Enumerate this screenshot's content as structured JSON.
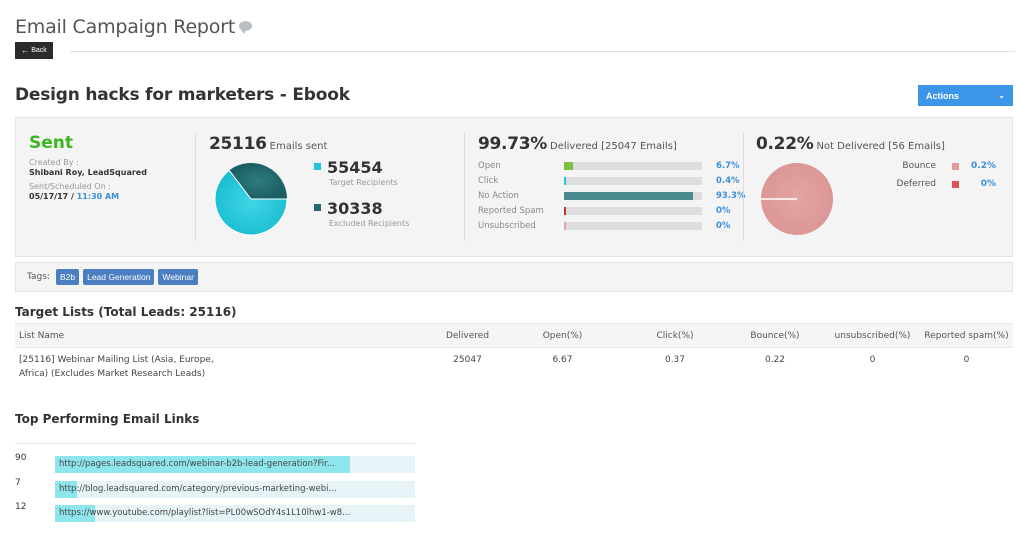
{
  "header": {
    "page_title": "Email Campaign Report",
    "back_label": "Back",
    "campaign_title": "Design hacks for marketers - Ebook",
    "actions_label": "Actions"
  },
  "status": {
    "label": "Sent",
    "created_by_label": "Created By :",
    "created_by": "Shibani Roy, LeadSquared",
    "scheduled_label": "Sent/Scheduled On :",
    "scheduled_date": "05/17/17 / ",
    "scheduled_time": "11:30 AM"
  },
  "sent": {
    "count": "25116",
    "suffix": "Emails sent",
    "target_count": "55454",
    "target_label": "Target Recipients",
    "excluded_count": "30338",
    "excluded_label": "Excluded Recipients",
    "colors": {
      "target": "#26c6da",
      "excluded": "#1f6b70"
    },
    "pie": {
      "target": 55454,
      "excluded": 30338
    }
  },
  "delivered": {
    "percent": "99.73%",
    "suffix": "Delivered [25047 Emails]",
    "metrics": [
      {
        "label": "Open",
        "value": "6.7%",
        "fraction": 0.067,
        "color": "#7ac143"
      },
      {
        "label": "Click",
        "value": "0.4%",
        "fraction": 0.004,
        "color": "#26c6da"
      },
      {
        "label": "No Action",
        "value": "93.3%",
        "fraction": 0.933,
        "color": "#4a8a8c"
      },
      {
        "label": "Reported Spam",
        "value": "0%",
        "fraction": 0.0,
        "color": "#c0392b"
      },
      {
        "label": "Unsubscribed",
        "value": "0%",
        "fraction": 0.0,
        "color": "#e8a0a0"
      }
    ]
  },
  "not_delivered": {
    "percent": "0.22%",
    "suffix": "Not Delivered [56 Emails]",
    "items": [
      {
        "label": "Bounce",
        "value": "0.2%",
        "color": "#e39a9a"
      },
      {
        "label": "Deferred",
        "value": "0%",
        "color": "#d9534f"
      }
    ]
  },
  "tags": {
    "label": "Tags:",
    "items": [
      "B2b",
      "Lead Generation",
      "Webinar"
    ]
  },
  "target_lists": {
    "title": "Target Lists (Total Leads: 25116)",
    "columns": [
      "List Name",
      "Delivered",
      "Open(%)",
      "Click(%)",
      "Bounce(%)",
      "unsubscribed(%)",
      "Reported spam(%)"
    ],
    "rows": [
      {
        "name_line1": "[25116] Webinar Mailing List (Asia, Europe,",
        "name_line2": "Africa) (Excludes Market Research Leads)",
        "delivered": "25047",
        "open": "6.67",
        "click": "0.37",
        "bounce": "0.22",
        "unsubscribed": "0",
        "spam": "0"
      }
    ]
  },
  "top_links": {
    "title": "Top Performing Email Links",
    "items": [
      {
        "count": "90",
        "url": "http://pages.leadsquared.com/webinar-b2b-lead-generation?Fir...",
        "fraction": 0.82
      },
      {
        "count": "7",
        "url": "http://blog.leadsquared.com/category/previous-marketing-webi...",
        "fraction": 0.06
      },
      {
        "count": "12",
        "url": "https://www.youtube.com/playlist?list=PL00wSOdY4s1L10lhw1-w8...",
        "fraction": 0.11
      }
    ]
  }
}
